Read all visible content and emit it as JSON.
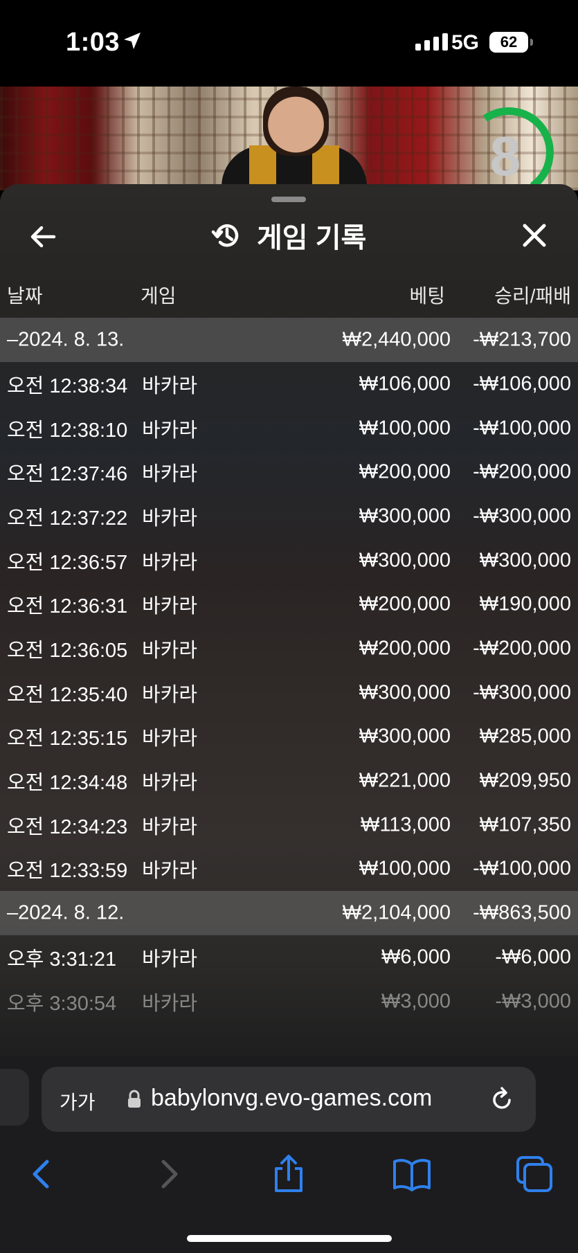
{
  "status_bar": {
    "time": "1:03",
    "network": "5G",
    "battery": "62"
  },
  "video": {
    "countdown": "8"
  },
  "sheet": {
    "title": "게임 기록",
    "columns": {
      "date": "날짜",
      "game": "게임",
      "bet": "베팅",
      "result": "승리/패배"
    },
    "groups": [
      {
        "date": "–2024. 8. 13.",
        "bet_total": "₩2,440,000",
        "result_total": "-₩213,700",
        "rows": [
          {
            "time": "오전 12:38:34",
            "game": "바카라",
            "bet": "₩106,000",
            "result": "-₩106,000"
          },
          {
            "time": "오전 12:38:10",
            "game": "바카라",
            "bet": "₩100,000",
            "result": "-₩100,000"
          },
          {
            "time": "오전 12:37:46",
            "game": "바카라",
            "bet": "₩200,000",
            "result": "-₩200,000"
          },
          {
            "time": "오전 12:37:22",
            "game": "바카라",
            "bet": "₩300,000",
            "result": "-₩300,000"
          },
          {
            "time": "오전 12:36:57",
            "game": "바카라",
            "bet": "₩300,000",
            "result": "₩300,000"
          },
          {
            "time": "오전 12:36:31",
            "game": "바카라",
            "bet": "₩200,000",
            "result": "₩190,000"
          },
          {
            "time": "오전 12:36:05",
            "game": "바카라",
            "bet": "₩200,000",
            "result": "-₩200,000"
          },
          {
            "time": "오전 12:35:40",
            "game": "바카라",
            "bet": "₩300,000",
            "result": "-₩300,000"
          },
          {
            "time": "오전 12:35:15",
            "game": "바카라",
            "bet": "₩300,000",
            "result": "₩285,000"
          },
          {
            "time": "오전 12:34:48",
            "game": "바카라",
            "bet": "₩221,000",
            "result": "₩209,950"
          },
          {
            "time": "오전 12:34:23",
            "game": "바카라",
            "bet": "₩113,000",
            "result": "₩107,350"
          },
          {
            "time": "오전 12:33:59",
            "game": "바카라",
            "bet": "₩100,000",
            "result": "-₩100,000"
          }
        ]
      },
      {
        "date": "–2024. 8. 12.",
        "bet_total": "₩2,104,000",
        "result_total": "-₩863,500",
        "rows": [
          {
            "time": "오후 3:31:21",
            "game": "바카라",
            "bet": "₩6,000",
            "result": "-₩6,000"
          },
          {
            "time": "오후 3:30:54",
            "game": "바카라",
            "bet": "₩3,000",
            "result": "-₩3,000"
          }
        ]
      }
    ]
  },
  "browser": {
    "text_size": "가가",
    "url": "babylonvg.evo-games.com"
  },
  "colors": {
    "accent_blue": "#2f80ed",
    "timer_green": "#17b24a"
  },
  "icons": [
    "location-arrow-icon",
    "back-arrow-icon",
    "history-icon",
    "close-icon",
    "lock-icon",
    "reload-icon",
    "nav-back-icon",
    "nav-forward-icon",
    "share-icon",
    "bookmarks-icon",
    "tabs-icon"
  ]
}
